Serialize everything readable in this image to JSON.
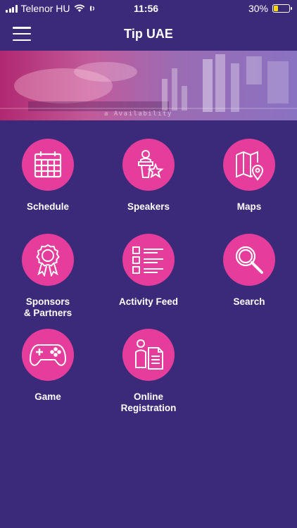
{
  "status_bar": {
    "carrier": "Telenor HU",
    "time": "11:56",
    "battery": "30%",
    "battery_level": 0.3
  },
  "header": {
    "title": "Tip UAE",
    "menu_icon": "hamburger-menu-icon"
  },
  "banner": {
    "text": "a Availability"
  },
  "menu": {
    "items": [
      {
        "label": "Schedule",
        "icon": "calendar-icon"
      },
      {
        "label": "Speakers",
        "icon": "speaker-podium-icon"
      },
      {
        "label": "Maps",
        "icon": "map-pin-icon"
      },
      {
        "label": "Sponsors\n& Partners",
        "icon": "award-ribbon-icon"
      },
      {
        "label": "Activity Feed",
        "icon": "list-icon"
      },
      {
        "label": "Search",
        "icon": "search-icon"
      },
      {
        "label": "Game",
        "icon": "gamepad-icon"
      },
      {
        "label": "Online\nRegistration",
        "icon": "registration-form-icon"
      }
    ]
  },
  "colors": {
    "background": "#3b2a7a",
    "accent": "#e63d9c",
    "text": "#ffffff",
    "battery": "#f5d90a"
  }
}
